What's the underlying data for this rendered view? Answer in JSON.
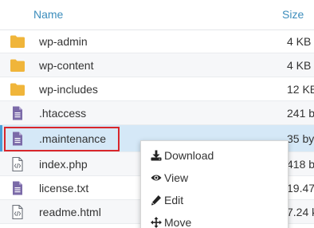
{
  "table": {
    "headers": {
      "name": "Name",
      "size": "Size"
    },
    "rows": [
      {
        "name": "wp-admin",
        "size": "4 KB",
        "type": "folder"
      },
      {
        "name": "wp-content",
        "size": "4 KB",
        "type": "folder"
      },
      {
        "name": "wp-includes",
        "size": "12 KB",
        "type": "folder"
      },
      {
        "name": ".htaccess",
        "size": "241 b",
        "type": "text"
      },
      {
        "name": ".maintenance",
        "size": "35 by",
        "type": "text"
      },
      {
        "name": "index.php",
        "size": "418 b",
        "type": "code"
      },
      {
        "name": "license.txt",
        "size": "19.47",
        "type": "text"
      },
      {
        "name": "readme.html",
        "size": "7.24 k",
        "type": "code"
      }
    ],
    "selected_row": ".maintenance"
  },
  "context_menu": {
    "items": [
      {
        "label": "Download",
        "icon": "download-icon"
      },
      {
        "label": "View",
        "icon": "eye-icon"
      },
      {
        "label": "Edit",
        "icon": "pencil-icon"
      },
      {
        "label": "Move",
        "icon": "move-arrows-icon"
      }
    ]
  },
  "colors": {
    "header_text": "#3c8dbc",
    "folder": "#f0b53a",
    "file": "#7b6aa8",
    "selected_row": "#d5e8f7",
    "highlight_border": "#d9262b"
  }
}
